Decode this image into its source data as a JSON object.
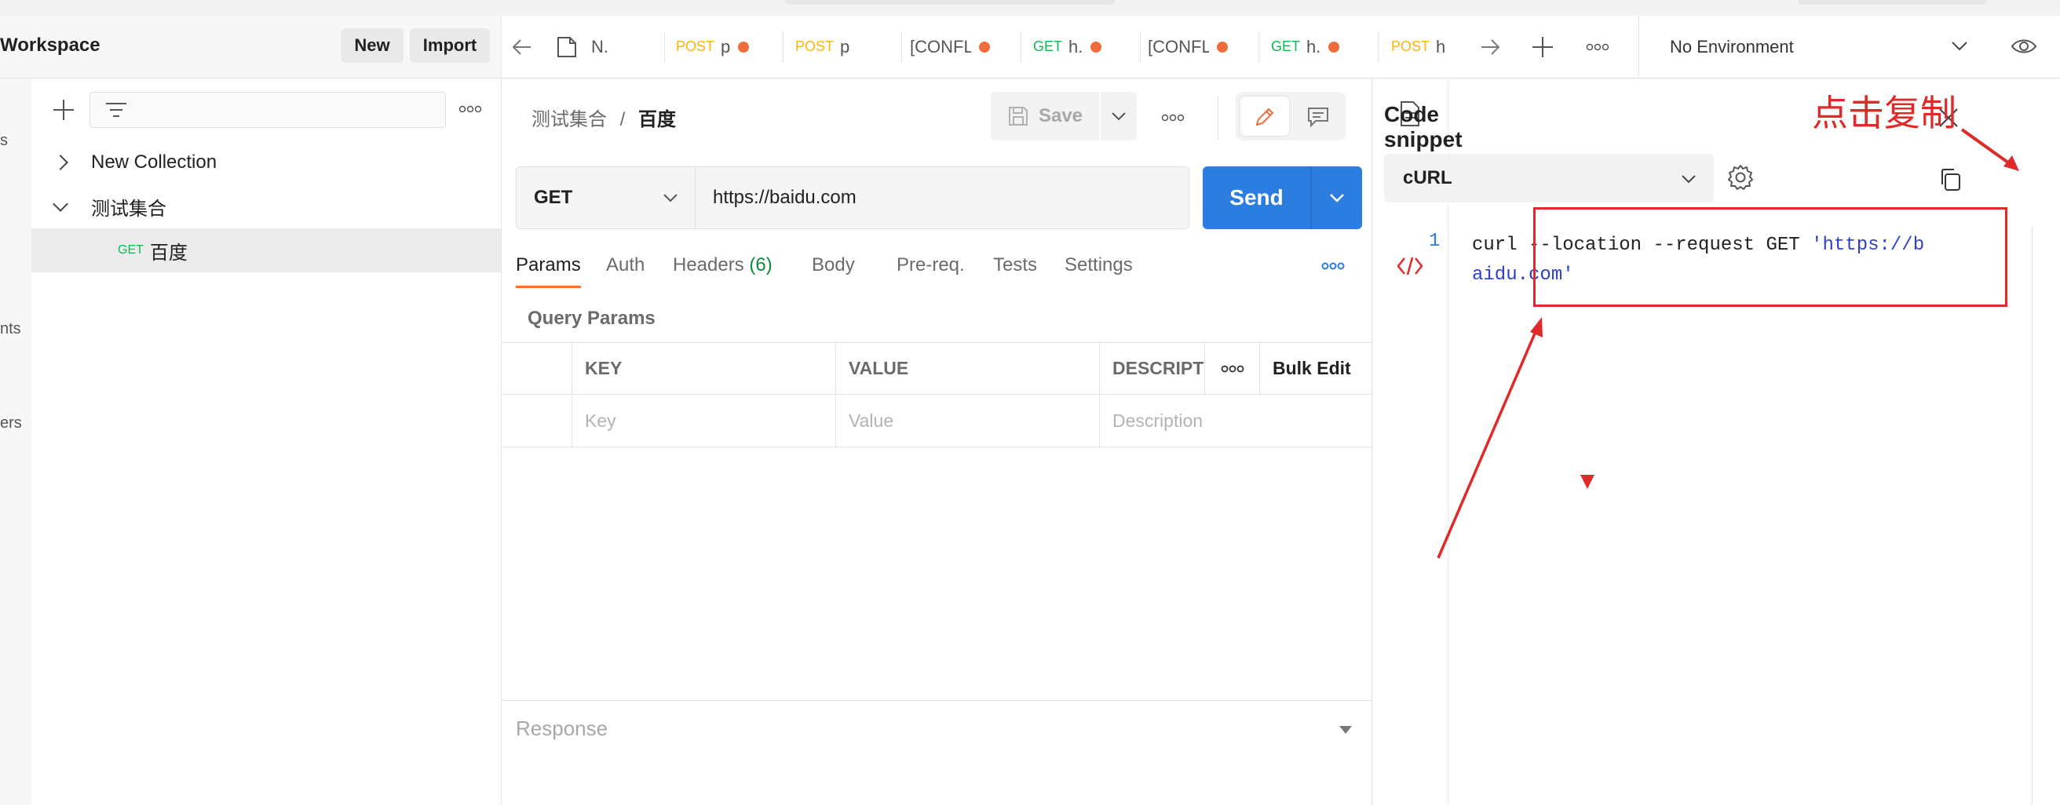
{
  "workspace": {
    "title": "Workspace",
    "new_label": "New",
    "import_label": "Import"
  },
  "rail": {
    "items": [
      "s",
      "nts",
      "ers"
    ]
  },
  "sidebar": {
    "tree": [
      {
        "label": "New Collection"
      },
      {
        "label": "测试集合"
      },
      {
        "method": "GET",
        "label": "百度"
      }
    ]
  },
  "tabs": [
    {
      "label": "N."
    },
    {
      "method": "POST",
      "label": "p"
    },
    {
      "method": "POST",
      "label": "p"
    },
    {
      "label": "[CONFL"
    },
    {
      "method": "GET",
      "label": "h."
    },
    {
      "label": "[CONFL"
    },
    {
      "method": "GET",
      "label": "h."
    },
    {
      "method": "POST",
      "label": "h"
    }
  ],
  "environment": "No Environment",
  "request": {
    "breadcrumb_parent": "测试集合",
    "breadcrumb_sep": "/",
    "breadcrumb_current": "百度",
    "save_label": "Save",
    "method": "GET",
    "url": "https://baidu.com",
    "send_label": "Send",
    "tabs": {
      "params": "Params",
      "auth": "Auth",
      "headers": "Headers",
      "headers_count": "(6)",
      "body": "Body",
      "prereq": "Pre-req.",
      "tests": "Tests",
      "settings": "Settings"
    },
    "query_params_title": "Query Params",
    "table": {
      "headers": [
        "KEY",
        "VALUE",
        "DESCRIPT"
      ],
      "bulk_edit": "Bulk Edit",
      "placeholders": [
        "Key",
        "Value",
        "Description"
      ]
    },
    "response_label": "Response"
  },
  "snippet": {
    "title": "Code snippet",
    "language": "cURL",
    "line_number": "1",
    "code_plain": "curl --location --request GET ",
    "code_string": "'https://baidu.com'",
    "annotation": "点击复制"
  },
  "colors": {
    "accent": "#2c7de0",
    "get": "#0cbb52",
    "post": "#ffb400",
    "unsaved_dot": "#ef6c3b",
    "annotation_red": "#e02a2a",
    "active_tab": "#ff6c37"
  }
}
